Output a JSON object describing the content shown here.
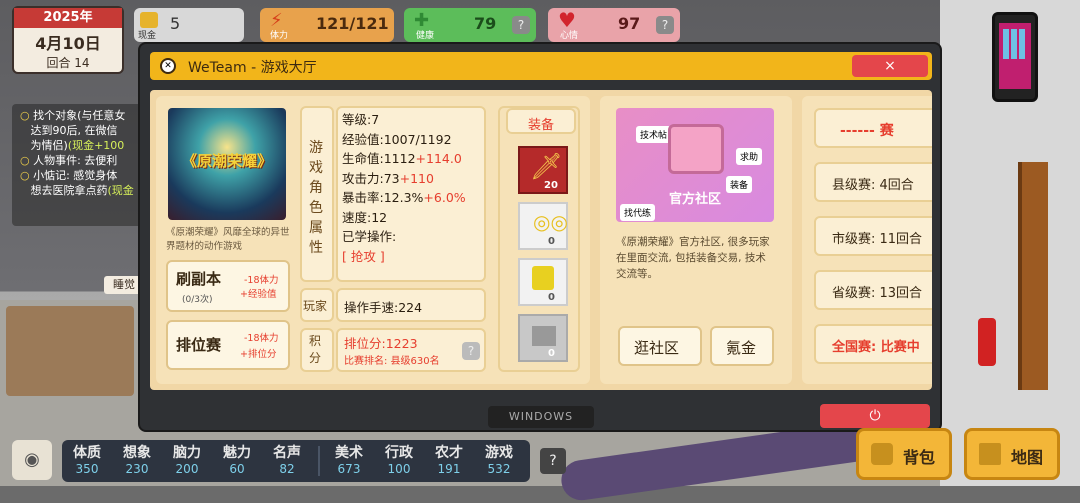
{
  "hud": {
    "year": "2025年",
    "date": "4月10日",
    "round": "回合 14",
    "cash_label": "现金",
    "cash_value": "5",
    "stamina_label": "体力",
    "stamina_value": "121/121",
    "health_label": "健康",
    "health_value": "79",
    "mood_label": "心情",
    "mood_value": "97",
    "help": "?"
  },
  "quests": [
    {
      "text": "找个对象(与任意女",
      "extra": "达到90后, 在微信",
      "extra2": "为情侣)",
      "reward": "(现金+100"
    },
    {
      "text": "人物事件: 去便利",
      "extra": "",
      "extra2": "",
      "reward": ""
    },
    {
      "text": "小惦记: 感觉身体",
      "extra": "想去医院拿点药",
      "extra2": "",
      "reward": "(现金"
    }
  ],
  "scene": {
    "sleep_label": "睡觉"
  },
  "window": {
    "title": "WeTeam - 游戏大厅",
    "close": "×",
    "footer": "WINDOWS",
    "power": "⏻"
  },
  "game": {
    "cover_title": "《原潮荣耀》",
    "desc": "《原潮荣耀》风靡全球的异世界题材的动作游戏",
    "dungeon_label": "刷副本",
    "dungeon_count": "(0/3次)",
    "dungeon_effect1": "-18体力",
    "dungeon_effect2": "+经验值",
    "ranked_label": "排位赛",
    "ranked_effect1": "-18体力",
    "ranked_effect2": "+排位分"
  },
  "attrs": {
    "side_label": "游戏角色属性",
    "level": "等级:7",
    "exp": "经验值:1007/1192",
    "hp": "生命值:1112",
    "hp_bonus": "+114.0",
    "atk": "攻击力:73",
    "atk_bonus": "+110",
    "crit": "暴击率:12.3%",
    "crit_bonus": "+6.0%",
    "speed": "速度:12",
    "learned": "已学操作:",
    "skill": "[ 抢攻 ]",
    "player_label": "玩家",
    "hand_speed": "操作手速:224",
    "score_label": "积分",
    "rank_points": "排位分:1223",
    "rank_name": "比赛排名: 县级630名",
    "help": "?"
  },
  "equipment": {
    "title": "装备",
    "slots": [
      {
        "icon": "sword-icon",
        "count": "20"
      },
      {
        "icon": "earrings-icon",
        "count": "0"
      },
      {
        "icon": "armor-icon",
        "count": "0"
      },
      {
        "icon": "boots-icon",
        "count": "0"
      }
    ]
  },
  "community": {
    "banner_title": "官方社区",
    "tags": [
      "技术帖",
      "求助",
      "装备",
      "找代练"
    ],
    "desc": "《原潮荣耀》官方社区, 很多玩家在里面交流, 包括装备交易, 技术交流等。",
    "browse": "逛社区",
    "pay": "氪金"
  },
  "matches": {
    "header": "------ 赛",
    "items": [
      {
        "label": "县级赛: 4回合",
        "highlight": false
      },
      {
        "label": "市级赛: 11回合",
        "highlight": false
      },
      {
        "label": "省级赛: 13回合",
        "highlight": false
      },
      {
        "label": "全国赛: 比赛中",
        "highlight": true
      }
    ]
  },
  "bottom": {
    "attributes": [
      {
        "name": "体质",
        "value": "350"
      },
      {
        "name": "想象",
        "value": "230"
      },
      {
        "name": "脑力",
        "value": "200"
      },
      {
        "name": "魅力",
        "value": "60"
      },
      {
        "name": "名声",
        "value": "82"
      },
      {
        "name": "美术",
        "value": "673"
      },
      {
        "name": "行政",
        "value": "100"
      },
      {
        "name": "农才",
        "value": "191"
      },
      {
        "name": "游戏",
        "value": "532"
      }
    ],
    "help": "?",
    "bag": "背包",
    "map": "地图"
  }
}
